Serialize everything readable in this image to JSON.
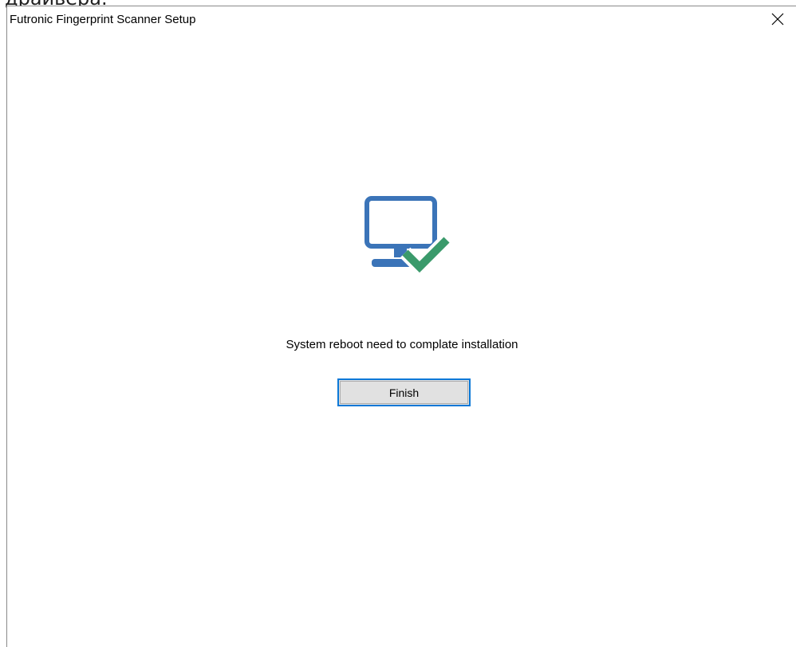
{
  "background": {
    "partial_text": "драйвера."
  },
  "window": {
    "title": "Futronic Fingerprint Scanner Setup",
    "close_icon": "close-icon"
  },
  "content": {
    "icon": "monitor-check-icon",
    "message": "System reboot need to complate installation",
    "finish_label": "Finish"
  },
  "colors": {
    "monitor": "#3b74b8",
    "check": "#3a9a6b",
    "button_border": "#0a78d7",
    "button_bg": "#e1e1e1"
  }
}
